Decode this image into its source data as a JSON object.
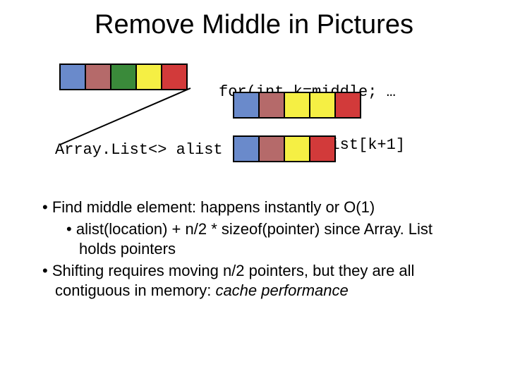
{
  "title": "Remove Middle in Pictures",
  "code": {
    "line1": "for(int k=middle; …",
    "line2": "   a[k] = alist[k+1]",
    "arraylist": "Array.List<> alist"
  },
  "arrays": {
    "a1": [
      "blue",
      "brown",
      "green",
      "yellow",
      "red"
    ],
    "a2": [
      "blue",
      "brown",
      "yellow",
      "yellow",
      "red"
    ],
    "a3": [
      "blue",
      "brown",
      "yellow",
      "red"
    ]
  },
  "bullets": {
    "b1": "Find middle element: happens instantly or O(1)",
    "b1a_prefix": "alist(location) + n/2 * sizeof(pointer) since Array. List holds pointers",
    "b2_prefix": "Shifting requires moving n/2 pointers, but they are all contiguous in memory: ",
    "b2_italic": "cache performance"
  }
}
